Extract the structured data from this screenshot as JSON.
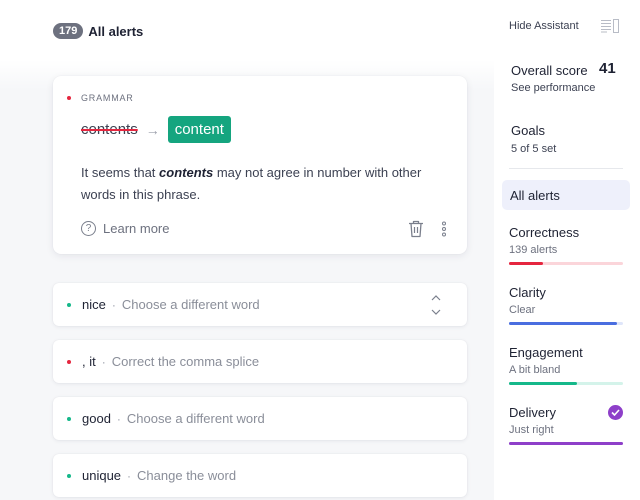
{
  "header": {
    "alert_count": "179",
    "title": "All alerts"
  },
  "active_card": {
    "category": "GRAMMAR",
    "category_color": "#e5263f",
    "original_word": "contents",
    "replacement_word": "content",
    "description_before": "It seems that ",
    "description_emphasis": "contents",
    "description_after": " may not agree in number with other words in this phrase.",
    "learn_more_label": "Learn more",
    "icons": [
      "arrow-right-icon",
      "help-circle-icon",
      "trash-icon",
      "more-vertical-icon"
    ]
  },
  "alerts": [
    {
      "word": "nice",
      "hint": "Choose a different word",
      "color": "#15b88a"
    },
    {
      "word": ", it",
      "hint": "Correct the comma splice",
      "color": "#e5263f"
    },
    {
      "word": "good",
      "hint": "Choose a different word",
      "color": "#15b88a"
    },
    {
      "word": "unique",
      "hint": "Change the word",
      "color": "#15b88a"
    }
  ],
  "alert_separator": "·",
  "sidebar": {
    "hide_assistant_label": "Hide Assistant",
    "overall_score_label": "Overall score",
    "overall_score_value": "41",
    "see_performance_label": "See performance",
    "goals_label": "Goals",
    "goals_status": "5 of 5 set",
    "all_alerts_label": "All alerts",
    "categories": [
      {
        "name": "Correctness",
        "status": "139 alerts",
        "progress": 0.3,
        "color": "#e5263f",
        "track": "#fbd5da",
        "checked": false
      },
      {
        "name": "Clarity",
        "status": "Clear",
        "progress": 0.95,
        "color": "#4a6ee0",
        "track": "#dfe6fa",
        "checked": false
      },
      {
        "name": "Engagement",
        "status": "A bit bland",
        "progress": 0.6,
        "color": "#15b88a",
        "track": "#d4f3ea",
        "checked": false
      },
      {
        "name": "Delivery",
        "status": "Just right",
        "progress": 1.0,
        "color": "#8e3fc9",
        "track": "#eadbf6",
        "checked": true
      }
    ]
  }
}
